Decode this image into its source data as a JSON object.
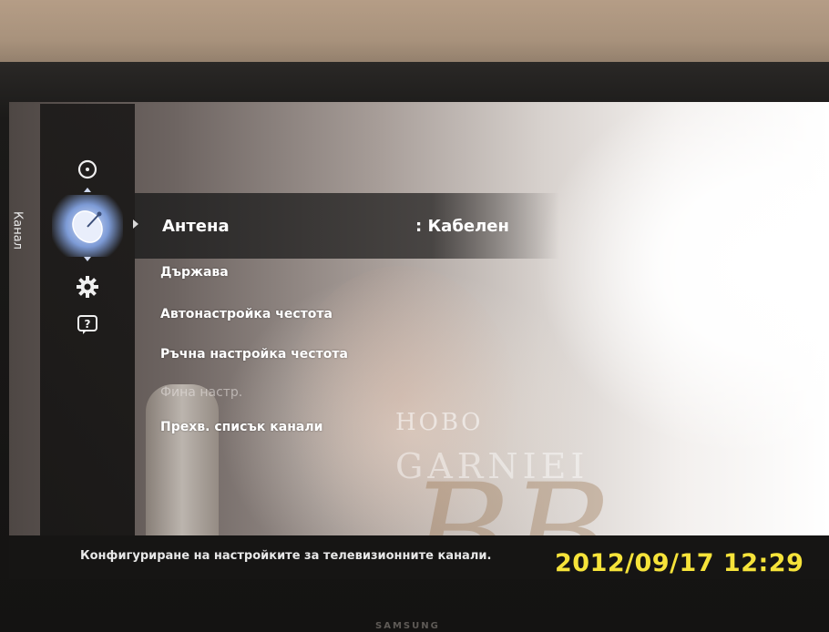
{
  "sidebar": {
    "section_label": "Канал",
    "icons": [
      "clock-icon",
      "satellite-dish-icon",
      "gear-icon",
      "help-icon"
    ],
    "selected": "satellite-dish-icon"
  },
  "menu": {
    "selected_item": {
      "label": "Антена",
      "value": ": Кабелен"
    },
    "items": [
      {
        "label": "Държава",
        "enabled": true
      },
      {
        "label": "Автонастройка честота",
        "enabled": true
      },
      {
        "label": "Ръчна настройка честота",
        "enabled": true
      },
      {
        "label": "Фина настр.",
        "enabled": false
      },
      {
        "label": "Прехв. списък канали",
        "enabled": true
      }
    ]
  },
  "background_ad": {
    "line1": "НОВО",
    "line2": "GARNIEI",
    "mark": "BB"
  },
  "help_text": "Конфигуриране на настройките за телевизионните канали.",
  "timestamp": "2012/09/17 12:29",
  "tv_brand": "SAMSUNG",
  "colors": {
    "timestamp": "#f6e33a",
    "menu_text": "#ffffff",
    "disabled_text": "#c8c2c0"
  }
}
